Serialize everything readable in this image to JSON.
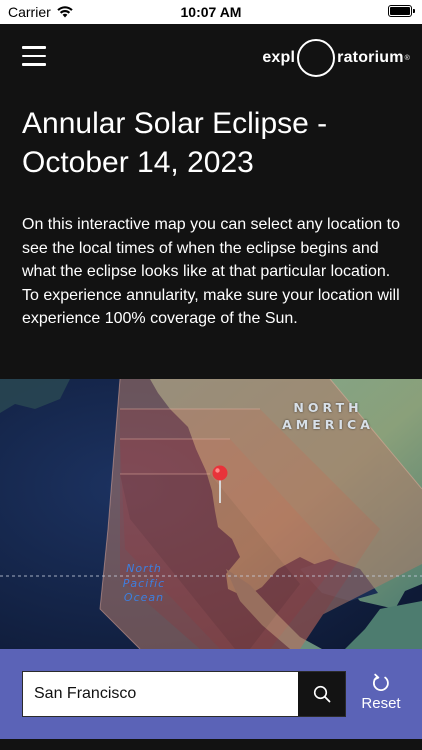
{
  "status_bar": {
    "carrier": "Carrier",
    "time": "10:07 AM",
    "wifi_icon": "wifi-icon",
    "battery_icon": "battery-icon",
    "battery_level_percent": 100
  },
  "header": {
    "menu_icon": "hamburger-menu-icon",
    "logo": {
      "left_text": "expl",
      "right_text": "ratorium",
      "mark": "®"
    }
  },
  "page": {
    "title": "Annular Solar Eclipse - October 14, 2023",
    "description": "On this interactive map you can select any location to see the local times of when the eclipse begins and what the eclipse looks like at that particular location. To experience annularity, make sure your location will experience 100% coverage of the Sun."
  },
  "map": {
    "labels": {
      "continent_line1": "NORTH",
      "continent_line2": "AMERICA",
      "ocean_line1": "North",
      "ocean_line2": "Pacific",
      "ocean_line3": "Ocean"
    },
    "marker_icon": "location-pin-icon",
    "colors": {
      "ocean": "#16264a",
      "land": "#6f9a84",
      "eclipse_band": "#c86b5c",
      "marker": "#e8333a"
    }
  },
  "search": {
    "value": "San Francisco",
    "placeholder": "",
    "search_icon": "search-icon",
    "reset_label": "Reset",
    "reset_icon": "reset-icon"
  },
  "colors": {
    "background": "#121212",
    "panel": "#5b63b7"
  }
}
